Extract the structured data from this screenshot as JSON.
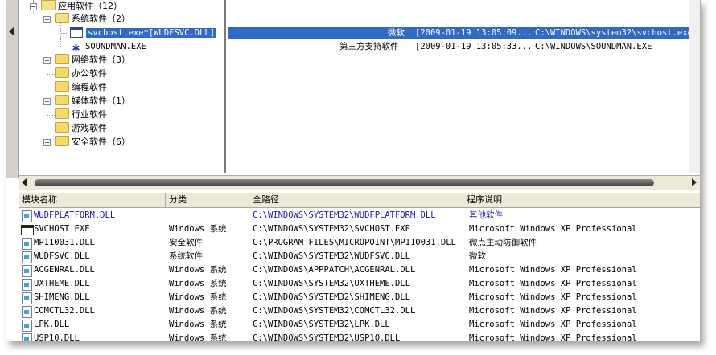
{
  "tree": {
    "nodes": [
      {
        "label": "应用软件（12）"
      },
      {
        "label": "系统软件（2）"
      },
      {
        "label": "svchost.exe*[WUDFSVC.DLL]"
      },
      {
        "label": "SOUNDMAN.EXE"
      },
      {
        "label": "网络软件（3）"
      },
      {
        "label": "办公软件"
      },
      {
        "label": "编程软件"
      },
      {
        "label": "媒体软件（1）"
      },
      {
        "label": "行业软件"
      },
      {
        "label": "游戏软件"
      },
      {
        "label": "安全软件（6）"
      }
    ]
  },
  "processes": [
    {
      "vendor": "微软",
      "time": "[2009-01-19 13:05:09...",
      "path": "C:\\WINDOWS\\system32\\svchost.exe"
    },
    {
      "vendor": "第三方支持软件",
      "time": "[2009-01-19 13:05:33...",
      "path": "C:\\WINDOWS\\SOUNDMAN.EXE"
    }
  ],
  "modules": {
    "columns": [
      "模块名称",
      "分类",
      "全路径",
      "程序说明"
    ],
    "rows": [
      {
        "name": "WUDFPLATFORM.DLL",
        "category": "",
        "path": "C:\\WINDOWS\\SYSTEM32\\WUDFPLATFORM.DLL",
        "desc": "其他软件",
        "icon": "dll-icon"
      },
      {
        "name": "SVCHOST.EXE",
        "category": "Windows 系统",
        "path": "C:\\WINDOWS\\SYSTEM32\\SVCHOST.EXE",
        "desc": "Microsoft Windows XP Professional",
        "icon": "exe-icon"
      },
      {
        "name": "MP110031.DLL",
        "category": "安全软件",
        "path": "C:\\PROGRAM FILES\\MICROPOINT\\MP110031.DLL",
        "desc": "微点主动防御软件",
        "icon": "dll-icon"
      },
      {
        "name": "WUDFSVC.DLL",
        "category": "系统软件",
        "path": "C:\\WINDOWS\\SYSTEM32\\WUDFSVC.DLL",
        "desc": "微软",
        "icon": "dll-icon"
      },
      {
        "name": "ACGENRAL.DLL",
        "category": "Windows 系统",
        "path": "C:\\WINDOWS\\APPPATCH\\ACGENRAL.DLL",
        "desc": "Microsoft Windows XP Professional",
        "icon": "dll-icon"
      },
      {
        "name": "UXTHEME.DLL",
        "category": "Windows 系统",
        "path": "C:\\WINDOWS\\SYSTEM32\\UXTHEME.DLL",
        "desc": "Microsoft Windows XP Professional",
        "icon": "dll-icon"
      },
      {
        "name": "SHIMENG.DLL",
        "category": "Windows 系统",
        "path": "C:\\WINDOWS\\SYSTEM32\\SHIMENG.DLL",
        "desc": "Microsoft Windows XP Professional",
        "icon": "dll-icon"
      },
      {
        "name": "COMCTL32.DLL",
        "category": "Windows 系统",
        "path": "C:\\WINDOWS\\SYSTEM32\\COMCTL32.DLL",
        "desc": "Microsoft Windows XP Professional",
        "icon": "dll-icon"
      },
      {
        "name": "LPK.DLL",
        "category": "Windows 系统",
        "path": "C:\\WINDOWS\\SYSTEM32\\LPK.DLL",
        "desc": "Microsoft Windows XP Professional",
        "icon": "dll-icon"
      },
      {
        "name": "USP10.DLL",
        "category": "Windows 系统",
        "path": "C:\\WINDOWS\\SYSTEM32\\USP10.DLL",
        "desc": "Microsoft Windows XP Professional",
        "icon": "dll-icon"
      }
    ]
  },
  "colors": {
    "selection": "#316ac5",
    "header_bg": "#ece9d8",
    "highlight_text": "#1a1aa6"
  }
}
